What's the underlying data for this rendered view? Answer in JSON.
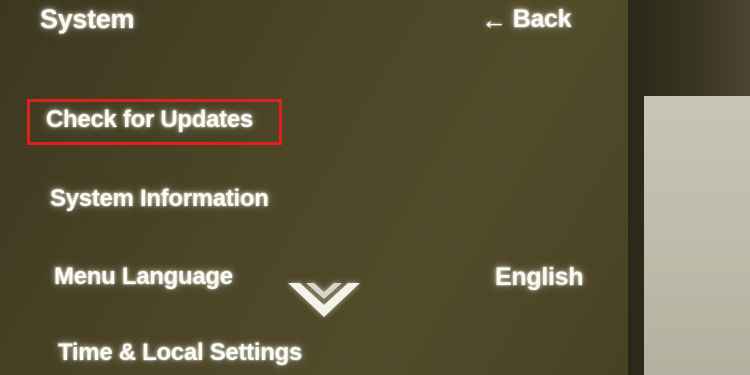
{
  "header": {
    "title": "System",
    "back_arrow": "←",
    "back_label": "Back"
  },
  "menu": {
    "items": [
      {
        "label": "Check for Updates",
        "selected": true
      },
      {
        "label": "System Information"
      },
      {
        "label": "Menu Language",
        "value": "English"
      },
      {
        "label": "Time & Local Settings"
      }
    ]
  },
  "icons": {
    "scroll_indicator": "chevron-down-icon"
  },
  "colors": {
    "highlight": "#e0201a",
    "text": "#fbfbf2"
  }
}
